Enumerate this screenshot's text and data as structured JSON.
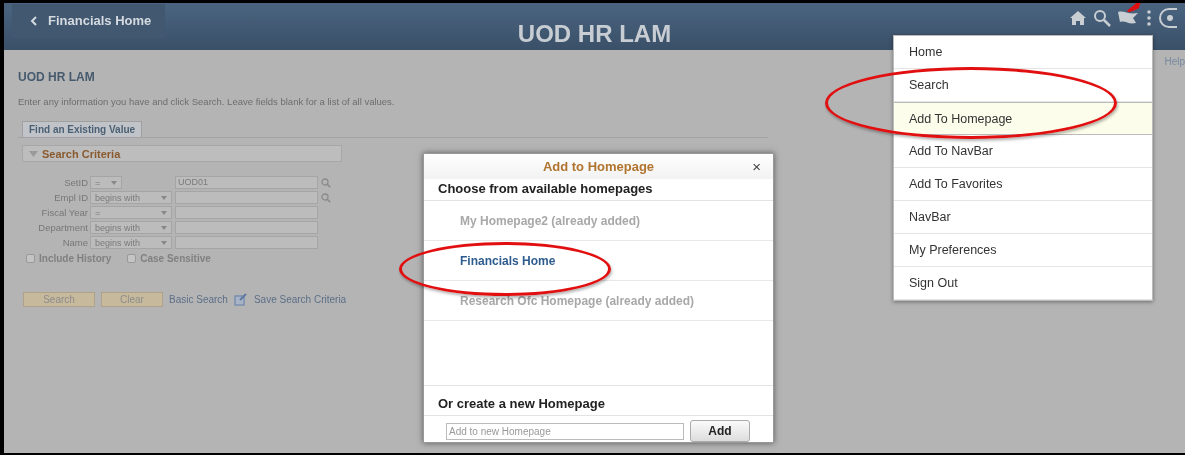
{
  "header": {
    "back_label": "Financials Home",
    "title": "UOD HR LAM",
    "help_link": "Help"
  },
  "page": {
    "title": "UOD HR LAM",
    "instructions": "Enter any information you have and click Search. Leave fields blank for a list of all values.",
    "tab": "Find an Existing Value",
    "section": "Search Criteria",
    "section_expanded": true,
    "criteria": [
      {
        "label": "SetID",
        "operator": "=",
        "value": "UOD01",
        "lookup": true,
        "wide": false
      },
      {
        "label": "Empl ID",
        "operator": "begins with",
        "lookup": true,
        "wide": true
      },
      {
        "label": "Fiscal Year",
        "operator": "=",
        "lookup": false,
        "wide": true
      },
      {
        "label": "Department",
        "operator": "begins with",
        "lookup": false,
        "wide": true
      },
      {
        "label": "Name",
        "operator": "begins with",
        "lookup": false,
        "wide": true
      }
    ],
    "checkboxes": [
      {
        "label": "Include History",
        "checked": false
      },
      {
        "label": "Case Sensitive",
        "checked": false
      }
    ],
    "buttons": [
      "Search",
      "Clear"
    ],
    "basic_search": "Basic Search",
    "save_search": "Save Search Criteria"
  },
  "dialog": {
    "title": "Add to Homepage",
    "close": "×",
    "heading": "Choose from available homepages",
    "homepages": [
      {
        "label": "My Homepage2 (already added)",
        "disabled": true,
        "circled": false
      },
      {
        "label": "Financials Home",
        "disabled": false,
        "circled": true
      },
      {
        "label": "Research Ofc Homepage (already added)",
        "disabled": true,
        "circled": false
      }
    ],
    "new_heading": "Or create a new Homepage",
    "placeholder": "Add to new Homepage",
    "add_button": "Add"
  },
  "menu": {
    "items": [
      {
        "label": "Home",
        "selected": false,
        "circled": false
      },
      {
        "label": "Search",
        "selected": false,
        "circled": false
      },
      {
        "label": "Add To Homepage",
        "selected": true,
        "circled": true
      },
      {
        "label": "Add To NavBar",
        "selected": false,
        "circled": false
      },
      {
        "label": "Add To Favorites",
        "selected": false,
        "circled": false
      },
      {
        "label": "NavBar",
        "selected": false,
        "circled": false
      },
      {
        "label": "My Preferences",
        "selected": false,
        "circled": false
      },
      {
        "label": "Sign Out",
        "selected": false,
        "circled": false
      }
    ]
  }
}
